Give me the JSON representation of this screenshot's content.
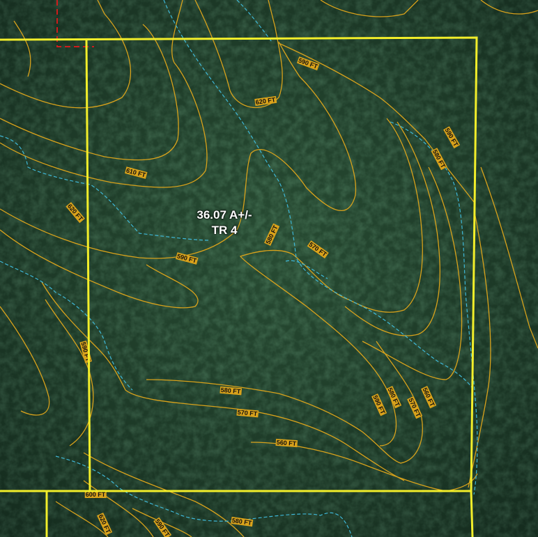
{
  "tract": {
    "acreage": "36.07 A+/-",
    "name": "TR 4"
  },
  "contour_labels": [
    "590 FT",
    "620 FT",
    "590 FT",
    "580 FT",
    "610 FT",
    "620 FT",
    "580 FT",
    "570 FT",
    "590 FT",
    "590 FT",
    "580 FT",
    "570 FT",
    "560 FT",
    "580 FT",
    "590 FT",
    "570 FT",
    "560 FT",
    "620 FT",
    "590 FT",
    "580 FT",
    "600 FT"
  ],
  "colors": {
    "imagery_base": "#1f3a2a",
    "contour": "#d9a21b",
    "stream": "#3fb8d8",
    "boundary": "#f2ee2a",
    "adjacent_boundary": "#d01c1c"
  }
}
